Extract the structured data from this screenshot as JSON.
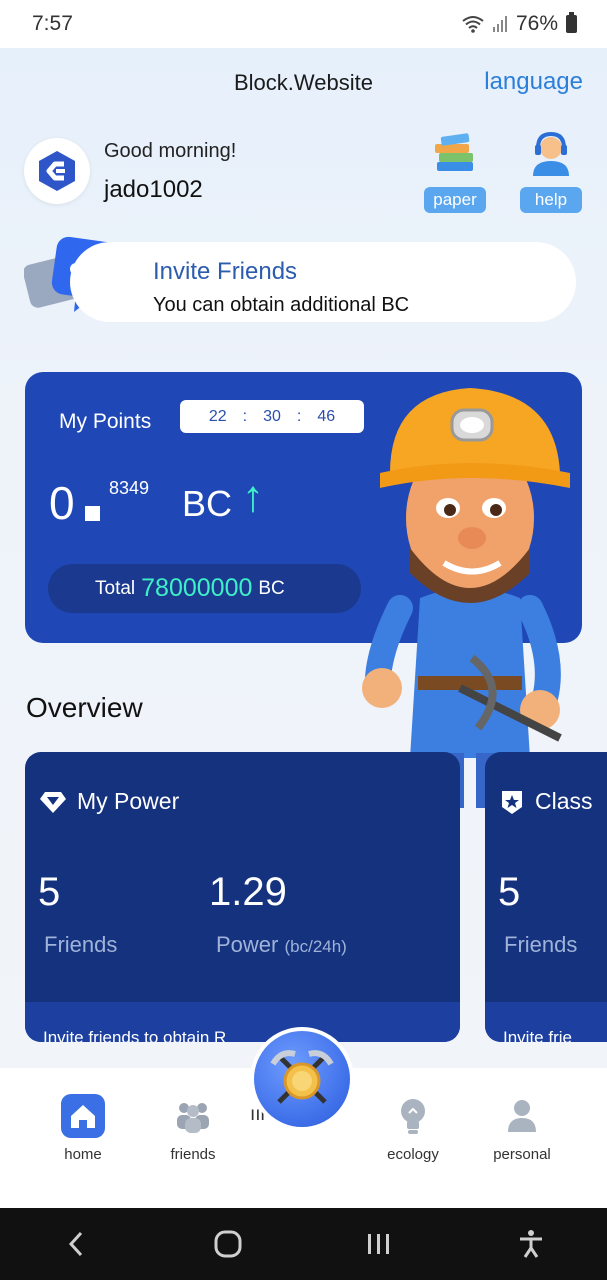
{
  "status": {
    "time": "7:57",
    "battery": "76%"
  },
  "header": {
    "title": "Block.Website",
    "language_label": "language"
  },
  "greeting": {
    "salutation": "Good morning!",
    "username": "jado1002"
  },
  "quick_actions": [
    {
      "label": "paper",
      "icon": "books-icon"
    },
    {
      "label": "help",
      "icon": "support-agent-icon"
    }
  ],
  "invite": {
    "title": "Invite Friends",
    "subtitle": "You can obtain additional BC"
  },
  "points": {
    "label": "My Points",
    "timer": {
      "hours": "22",
      "minutes": "30",
      "seconds": "46",
      "sep": ":"
    },
    "integer": "0",
    "decimal": "8349",
    "unit": "BC",
    "trend_glyph": "↑",
    "total_label": "Total",
    "total_value": "78000000",
    "total_unit": "BC"
  },
  "overview": {
    "title": "Overview",
    "cards": [
      {
        "title": "My Power",
        "friends_value": "5",
        "friends_label": "Friends",
        "power_value": "1.29",
        "power_label": "Power",
        "power_unit": "(bc/24h)",
        "footer": "Invite friends to obtain  R"
      },
      {
        "title": "Class",
        "friends_value": "5",
        "friends_label": "Friends",
        "footer": "Invite frie"
      }
    ]
  },
  "tabs": [
    {
      "label": "home",
      "icon": "home-icon",
      "active": true
    },
    {
      "label": "friends",
      "icon": "people-icon",
      "active": false
    },
    {
      "label": "ecology",
      "icon": "lightbulb-icon",
      "active": false
    },
    {
      "label": "personal",
      "icon": "person-icon",
      "active": false
    }
  ],
  "mine_label": "ıır  ıe r",
  "colors": {
    "primary_blue": "#1f47b6",
    "card_navy": "#15327f",
    "accent_teal": "#3ef0c6",
    "link_blue": "#2b7fd8",
    "pill_blue": "#5aa7ef"
  }
}
